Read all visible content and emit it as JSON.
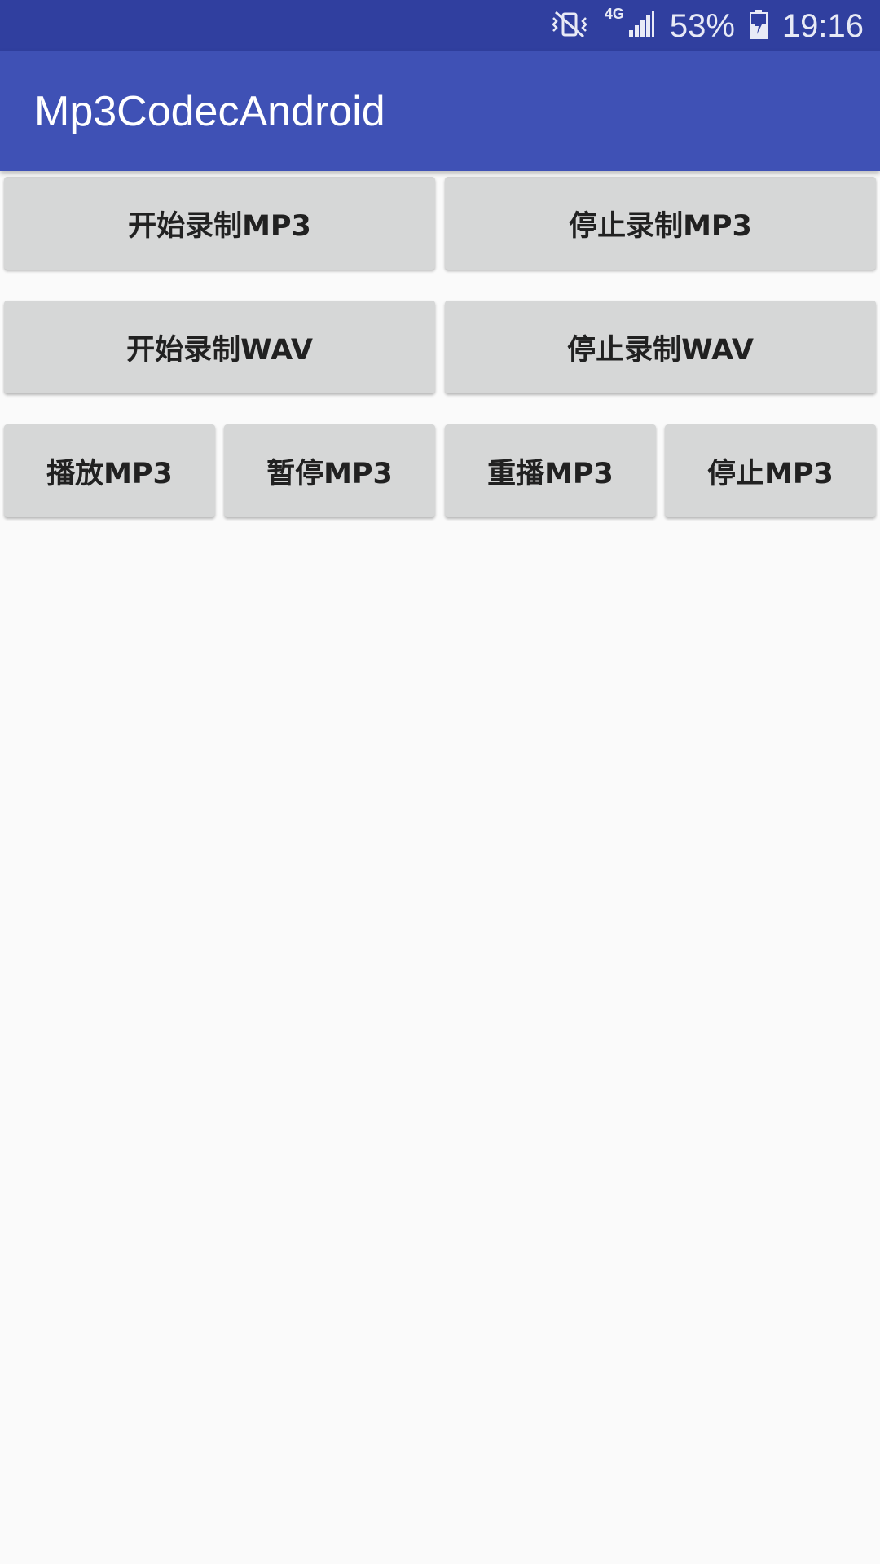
{
  "status_bar": {
    "network_label": "4G",
    "battery_percent": "53%",
    "time": "19:16",
    "icons": [
      "vibrate-mute-icon",
      "signal-icon",
      "battery-charging-icon"
    ]
  },
  "app_bar": {
    "title": "Mp3CodecAndroid"
  },
  "buttons": {
    "start_record_mp3": "开始录制MP3",
    "stop_record_mp3": "停止录制MP3",
    "start_record_wav": "开始录制WAV",
    "stop_record_wav": "停止录制WAV",
    "play_mp3": "播放MP3",
    "pause_mp3": "暂停MP3",
    "replay_mp3": "重播MP3",
    "stop_mp3": "停止MP3"
  },
  "colors": {
    "status_bar": "#303f9f",
    "app_bar": "#3f51b5",
    "background": "#fafafa",
    "button": "#d6d7d7"
  }
}
